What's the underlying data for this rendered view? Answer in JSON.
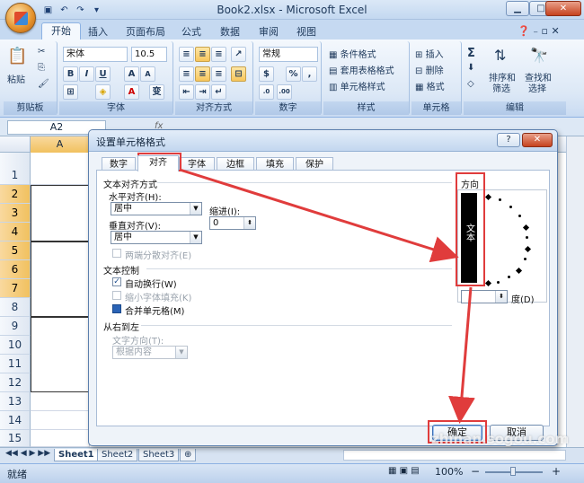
{
  "window": {
    "title": "Book2.xlsx - Microsoft Excel",
    "min": "▁",
    "max": "□",
    "close": "✕"
  },
  "ribbon_tabs": [
    "开始",
    "插入",
    "页面布局",
    "公式",
    "数据",
    "审阅",
    "视图"
  ],
  "ribbon": {
    "clipboard": {
      "label": "剪贴板",
      "paste": "粘贴"
    },
    "font": {
      "label": "字体",
      "family": "宋体",
      "size": "10.5",
      "bold": "B",
      "italic": "I",
      "underline": "U",
      "grow": "A",
      "shrink": "A",
      "wen": "变"
    },
    "alignment": {
      "label": "对齐方式"
    },
    "number": {
      "label": "数字",
      "format": "常规",
      "percent": "%",
      "comma": ","
    },
    "styles": {
      "label": "样式",
      "cond": "条件格式",
      "table": "套用表格格式",
      "cell": "单元格样式"
    },
    "cells": {
      "label": "单元格",
      "insert": "插入",
      "delete": "删除",
      "format": "格式"
    },
    "editing": {
      "label": "编辑",
      "sort": "排序和",
      "sort2": "筛选",
      "find": "查找和",
      "find2": "选择",
      "sigma": "Σ"
    }
  },
  "formula_bar": {
    "name_box": "A2",
    "fx": "fx"
  },
  "sheet": {
    "column": "A",
    "rows": [
      "1",
      "2",
      "3",
      "4",
      "5",
      "6",
      "7",
      "8",
      "9",
      "10",
      "11",
      "12",
      "13",
      "14",
      "15"
    ]
  },
  "sheet_tabs": [
    "Sheet1",
    "Sheet2",
    "Sheet3"
  ],
  "status": {
    "ready": "就绪",
    "zoom": "100%",
    "minus": "−",
    "plus": "+"
  },
  "dialog": {
    "title": "设置单元格格式",
    "help": "?",
    "close": "✕",
    "tabs": [
      "数字",
      "对齐",
      "字体",
      "边框",
      "填充",
      "保护"
    ],
    "section_text_align": "文本对齐方式",
    "horizontal_label": "水平对齐(H):",
    "horizontal_value": "居中",
    "indent_label": "缩进(I):",
    "indent_value": "0",
    "vertical_label": "垂直对齐(V):",
    "vertical_value": "居中",
    "distributed": "两端分散对齐(E)",
    "section_text_control": "文本控制",
    "wrap_text": "自动换行(W)",
    "shrink_to_fit": "缩小字体填充(K)",
    "merge_cells": "合并单元格(M)",
    "section_rtl": "从右到左",
    "text_direction_label": "文字方向(T):",
    "text_direction_value": "根据内容",
    "orientation_label": "方向",
    "orientation_text": "文本",
    "degrees_label": "度(D)",
    "degrees_value": "",
    "ok": "确定",
    "cancel": "取消"
  },
  "watermark": "zhinan.sogou.com",
  "colors": {
    "annotation_red": "#e03c3c",
    "ribbon_blue": "#c5d9f1"
  }
}
